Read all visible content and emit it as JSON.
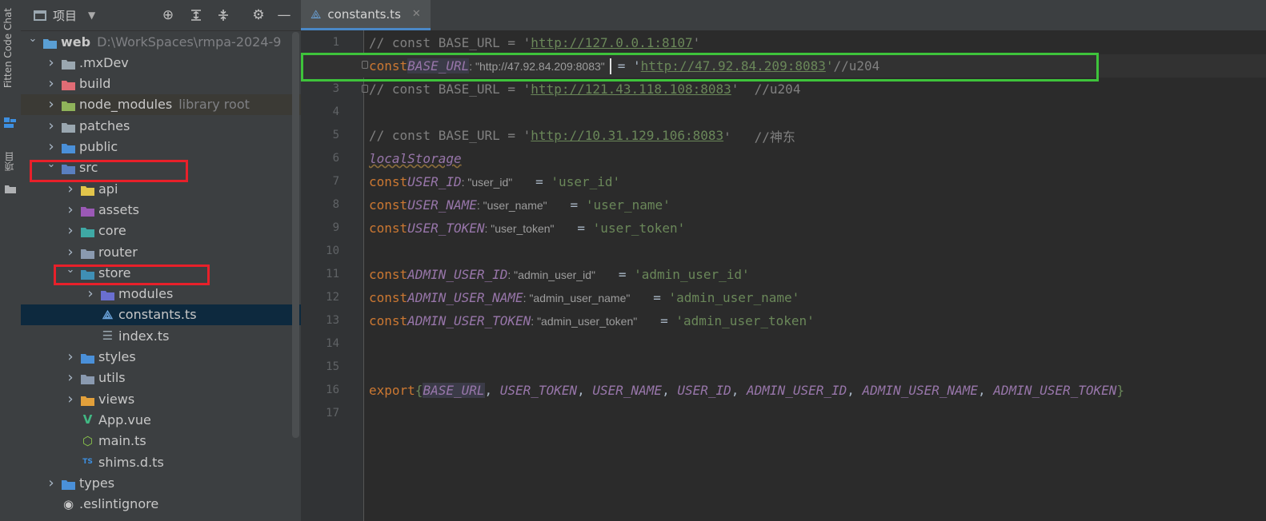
{
  "left_strip": {
    "fitten_label": "Fitten Code Chat",
    "project_label": "项目"
  },
  "project_panel": {
    "title": "项目",
    "tree": [
      {
        "label": "web",
        "secondary": "D:\\WorkSpaces\\rmpa-2024-9",
        "level": 0,
        "expanded": true,
        "icon": "module-folder-icon",
        "color": "#5a9fd4"
      },
      {
        "label": ".mxDev",
        "level": 1,
        "expanded": false,
        "icon": "folder-icon",
        "color": "#9aa7b0"
      },
      {
        "label": "build",
        "level": 1,
        "expanded": false,
        "icon": "folder-icon",
        "color": "#e06c75"
      },
      {
        "label": "node_modules",
        "secondary": "library root",
        "level": 1,
        "expanded": false,
        "icon": "folder-icon",
        "color": "#8fb35a"
      },
      {
        "label": "patches",
        "level": 1,
        "expanded": false,
        "icon": "folder-icon",
        "color": "#9aa7b0"
      },
      {
        "label": "public",
        "level": 1,
        "expanded": false,
        "icon": "folder-icon",
        "color": "#4a90d9"
      },
      {
        "label": "src",
        "level": 1,
        "expanded": true,
        "icon": "source-folder-icon",
        "color": "#5a7fc0"
      },
      {
        "label": "api",
        "level": 2,
        "expanded": false,
        "icon": "folder-icon",
        "color": "#e2c54b"
      },
      {
        "label": "assets",
        "level": 2,
        "expanded": false,
        "icon": "folder-icon",
        "color": "#9b59b6"
      },
      {
        "label": "core",
        "level": 2,
        "expanded": false,
        "icon": "folder-icon",
        "color": "#3fa9a5"
      },
      {
        "label": "router",
        "level": 2,
        "expanded": false,
        "icon": "folder-icon",
        "color": "#8a9ab0"
      },
      {
        "label": "store",
        "level": 2,
        "expanded": true,
        "icon": "folder-icon",
        "color": "#3f8fb5"
      },
      {
        "label": "modules",
        "level": 3,
        "expanded": false,
        "icon": "folder-icon",
        "color": "#6a6fd0"
      },
      {
        "label": "constants.ts",
        "level": 3,
        "leaf": true,
        "icon": "ts-file-icon",
        "selected": true
      },
      {
        "label": "index.ts",
        "level": 3,
        "leaf": true,
        "icon": "index-file-icon"
      },
      {
        "label": "styles",
        "level": 2,
        "expanded": false,
        "icon": "folder-icon",
        "color": "#4a90d9"
      },
      {
        "label": "utils",
        "level": 2,
        "expanded": false,
        "icon": "folder-icon",
        "color": "#8a9ab0"
      },
      {
        "label": "views",
        "level": 2,
        "expanded": false,
        "icon": "folder-icon",
        "color": "#e2a03b"
      },
      {
        "label": "App.vue",
        "level": 2,
        "leaf": true,
        "icon": "vue-file-icon"
      },
      {
        "label": "main.ts",
        "level": 2,
        "leaf": true,
        "icon": "node-file-icon"
      },
      {
        "label": "shims.d.ts",
        "level": 2,
        "leaf": true,
        "icon": "ts-declaration-icon"
      },
      {
        "label": "types",
        "level": 1,
        "expanded": false,
        "icon": "folder-icon",
        "color": "#4a90d9"
      },
      {
        "label": ".eslintignore",
        "level": 1,
        "leaf": true,
        "icon": "eslint-file-icon"
      }
    ]
  },
  "editor": {
    "tab_label": "constants.ts",
    "line_numbers": [
      "1",
      "2",
      "3",
      "4",
      "5",
      "6",
      "7",
      "8",
      "9",
      "10",
      "11",
      "12",
      "13",
      "14",
      "15",
      "16",
      "17"
    ],
    "lines": {
      "l1": {
        "comment_prefix": "// const BASE_URL = '",
        "url": "http://127.0.0.1:8107",
        "comment_suffix": "'"
      },
      "l2": {
        "kw": "const",
        "name": "BASE_URL",
        "hint": ": \"http://47.92.84.209:8083\"",
        "eq": "= '",
        "url": "http://47.92.84.209:8083",
        "close": "'",
        "comment": "//u204"
      },
      "l3": {
        "comment_prefix": "// const BASE_URL = '",
        "url": "http://121.43.118.108:8083",
        "comment_suffix": "'  //u204"
      },
      "l5": {
        "comment_prefix": "// const BASE_URL = '",
        "url": "http://10.31.129.106:8083",
        "comment_suffix": "'   //神东"
      },
      "l6": {
        "text": "localStorage"
      },
      "l7": {
        "kw": "const",
        "name": "USER_ID",
        "hint": ": \"user_id\"",
        "value": "'user_id'"
      },
      "l8": {
        "kw": "const",
        "name": "USER_NAME",
        "hint": ": \"user_name\"",
        "value": "'user_name'"
      },
      "l9": {
        "kw": "const",
        "name": "USER_TOKEN",
        "hint": ": \"user_token\"",
        "value": "'user_token'"
      },
      "l11": {
        "kw": "const",
        "name": "ADMIN_USER_ID",
        "hint": ": \"admin_user_id\"",
        "value": "'admin_user_id'"
      },
      "l12": {
        "kw": "const",
        "name": "ADMIN_USER_NAME",
        "hint": ": \"admin_user_name\"",
        "value": "'admin_user_name'"
      },
      "l13": {
        "kw": "const",
        "name": "ADMIN_USER_TOKEN",
        "hint": ": \"admin_user_token\"",
        "value": "'admin_user_token'"
      },
      "l16": {
        "kw": "export",
        "open": "{",
        "first": "BASE_URL",
        "rest": [
          "USER_TOKEN",
          "USER_NAME",
          "USER_ID",
          "ADMIN_USER_ID",
          "ADMIN_USER_NAME",
          "ADMIN_USER_TOKEN"
        ],
        "sep": ", ",
        "close": "}"
      }
    }
  },
  "colors": {
    "annotation_red": "#e8202a",
    "annotation_green": "#3ec33b",
    "accent": "#4a88c7"
  }
}
